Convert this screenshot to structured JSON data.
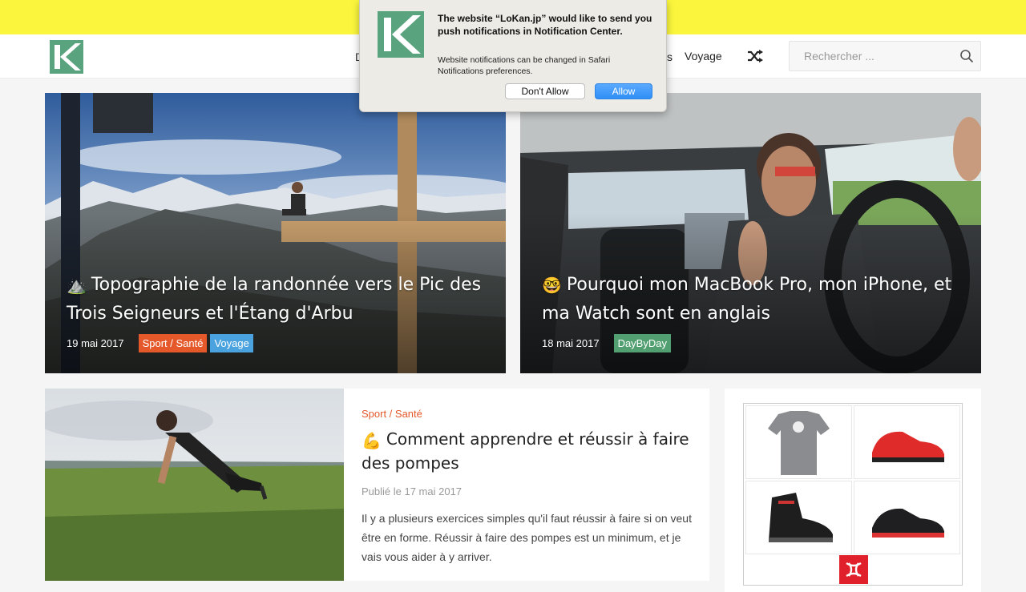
{
  "site": {
    "brand_color": "#5aa37f",
    "topbar_color": "#fbf63d"
  },
  "nav": {
    "hidden_left": "D",
    "hidden_right": "s",
    "voyage": "Voyage",
    "shuffle_icon": "shuffle-icon"
  },
  "search": {
    "placeholder": "Rechercher ..."
  },
  "featured": [
    {
      "emoji": "⛰️",
      "title": "Topographie de la randonnée vers le Pic des Trois Seigneurs et l'Étang d'Arbu",
      "date": "19 mai 2017",
      "tags": [
        "Sport / Santé",
        "Voyage"
      ]
    },
    {
      "emoji": "🤓",
      "title": "Pourquoi mon MacBook Pro, mon iPhone, et ma Watch sont en anglais",
      "date": "18 mai 2017",
      "tags": [
        "DayByDay"
      ]
    }
  ],
  "post": {
    "category": "Sport / Santé",
    "emoji": "💪",
    "title": "Comment apprendre et réussir à faire des pompes",
    "date": "Publié le 17 mai 2017",
    "excerpt": "Il y a plusieurs exercices simples qu'il faut réussir à faire si on veut être en forme. Réussir à faire des pompes est un minimum, et je vais vous aider à y arriver."
  },
  "notification": {
    "title": "The website “LoKan.jp” would like to send you push notifications in Notification Center.",
    "text": "Website notifications can be changed in Safari Notifications preferences.",
    "deny": "Don't Allow",
    "allow": "Allow"
  }
}
